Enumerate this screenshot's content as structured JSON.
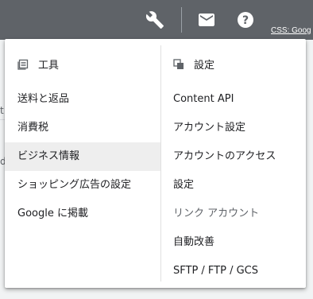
{
  "topbar": {
    "icons": [
      "wrench-icon",
      "mail-icon",
      "help-icon"
    ],
    "css_link": "CSS: Goog"
  },
  "tools": {
    "icon": "tools-icon",
    "header": "工具",
    "items": [
      {
        "label": "送料と返品"
      },
      {
        "label": "消費税"
      },
      {
        "label": "ビジネス情報",
        "active": true
      },
      {
        "label": "ショッピング広告の設定"
      },
      {
        "label": "Google に掲載"
      }
    ]
  },
  "settings": {
    "icon": "settings-icon",
    "header": "設定",
    "items": [
      {
        "label": "Content API"
      },
      {
        "label": "アカウント設定"
      },
      {
        "label": "アカウントのアクセス"
      },
      {
        "label": "設定"
      },
      {
        "label": "リンク アカウント"
      },
      {
        "label": "自動改善"
      },
      {
        "label": "SFTP / FTP / GCS"
      }
    ]
  },
  "colors": {
    "topbar": "#5f6368",
    "menu_bg": "#ffffff",
    "active_bg": "#eeeeee",
    "text": "#202124"
  }
}
